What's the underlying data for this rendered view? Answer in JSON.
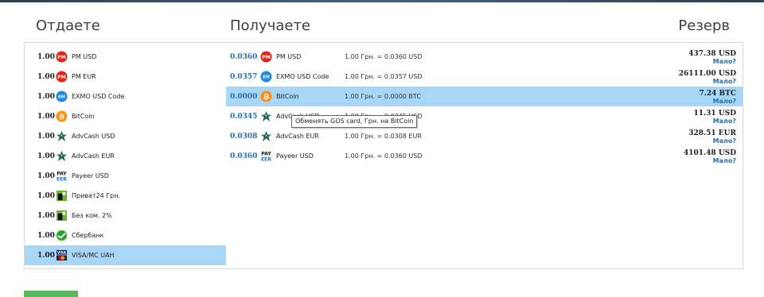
{
  "headers": {
    "give": "Отдаете",
    "get": "Получаете",
    "reserve": "Резерв"
  },
  "give_list": [
    {
      "amount": "1.00",
      "name": "PM USD",
      "icon": "pm-icon"
    },
    {
      "amount": "1.00",
      "name": "PM EUR",
      "icon": "pm-icon"
    },
    {
      "amount": "1.00",
      "name": "EXMO USD Code",
      "icon": "exmo-icon"
    },
    {
      "amount": "1.00",
      "name": "BitCoin",
      "icon": "bitcoin-icon"
    },
    {
      "amount": "1.00",
      "name": "AdvCash USD",
      "icon": "advcash-icon"
    },
    {
      "amount": "1.00",
      "name": "AdvCash EUR",
      "icon": "advcash-icon"
    },
    {
      "amount": "1.00",
      "name": "Payeer USD",
      "icon": "payeer-icon"
    },
    {
      "amount": "1.00",
      "name": "Приват24 Грн.",
      "icon": "privat24-icon"
    },
    {
      "amount": "1.00",
      "name": "Без ком. 2%",
      "icon": "privat24-icon"
    },
    {
      "amount": "1.00",
      "name": "Сбербанк",
      "icon": "sberbank-icon"
    },
    {
      "amount": "1.00",
      "name": "VISA/MC UAH",
      "icon": "visa-mc-icon",
      "selected": true
    }
  ],
  "get_list": [
    {
      "rate": "0.0360",
      "name": "PM USD",
      "icon": "pm-icon",
      "desc": "1.00 Грн. = 0.0360 USD",
      "reserve": "437.38",
      "currency": "USD",
      "low": "Мало?"
    },
    {
      "rate": "0.0357",
      "name": "EXMO USD Code",
      "icon": "exmo-icon",
      "desc": "1.00 Грн. = 0.0357 USD",
      "reserve": "26111.00",
      "currency": "USD",
      "low": "Мало?"
    },
    {
      "rate": "0.0000",
      "name": "BitCoin",
      "icon": "bitcoin-icon",
      "desc": "1.00 Грн. = 0.0000 BTC",
      "reserve": "7.24",
      "currency": "BTC",
      "low": "Мало?",
      "selected": true
    },
    {
      "rate": "0.0345",
      "name": "AdvCash USD",
      "icon": "advcash-icon",
      "desc": "1.00 Грн. = 0.0345 USD",
      "reserve": "11.31",
      "currency": "USD",
      "low": "Мало?"
    },
    {
      "rate": "0.0308",
      "name": "AdvCash EUR",
      "icon": "advcash-icon",
      "desc": "1.00 Грн. = 0.0308 EUR",
      "reserve": "328.51",
      "currency": "EUR",
      "low": "Мало?"
    },
    {
      "rate": "0.0360",
      "name": "Payeer USD",
      "icon": "payeer-icon",
      "desc": "1.00 Грн. = 0.0360 USD",
      "reserve": "4101.48",
      "currency": "USD",
      "low": "Мало?"
    }
  ],
  "tooltip": "Обменять GOS card, Грн. на BitCoin",
  "colors": {
    "selected_row": "#a8d6f6",
    "rate_text": "#2a6da9",
    "accent_green": "#5cb85c"
  }
}
